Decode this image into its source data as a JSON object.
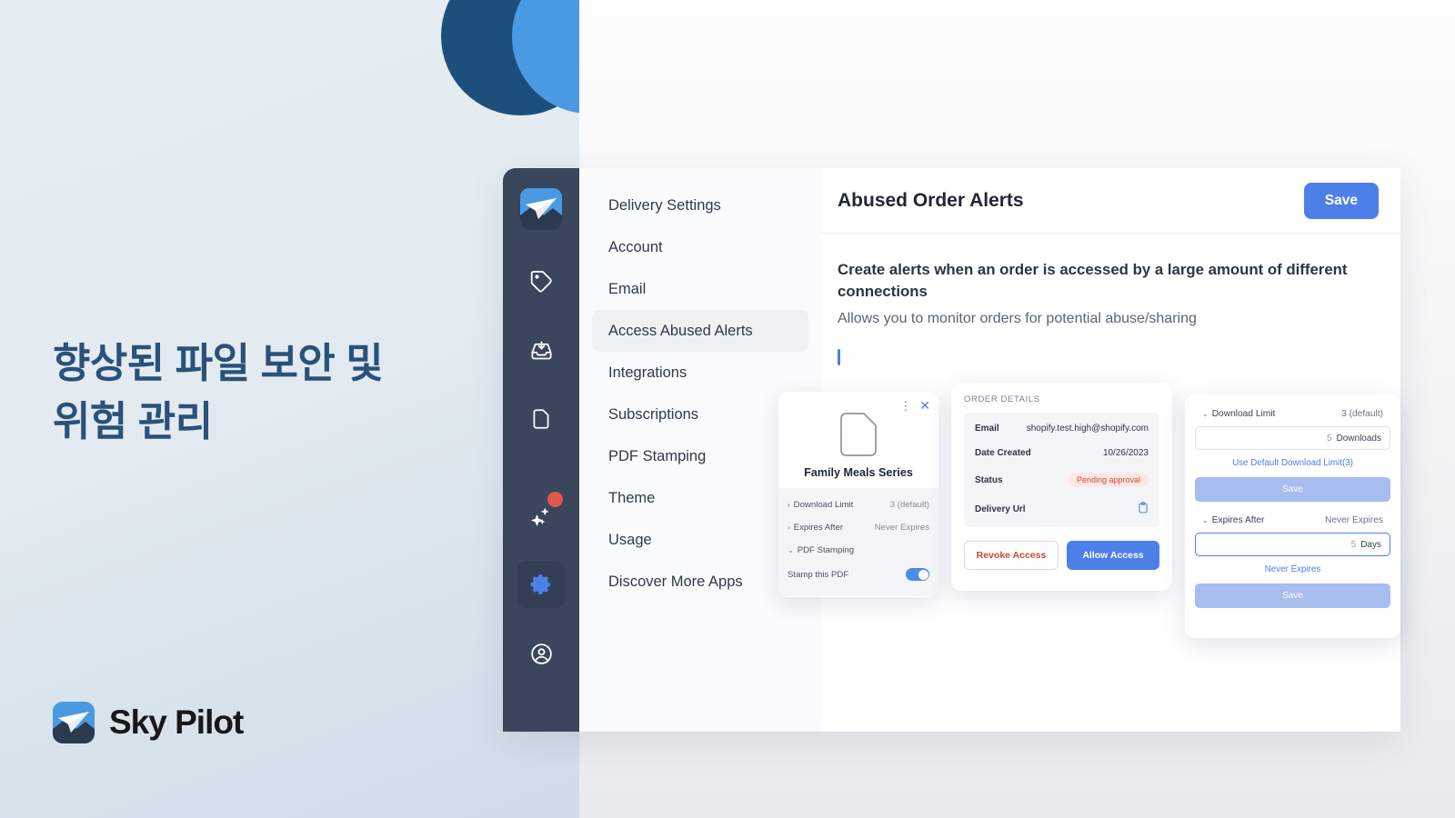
{
  "hero": {
    "headline_line1": "향상된 파일 보안 및",
    "headline_line2": "위험 관리",
    "brand": "Sky Pilot"
  },
  "colors": {
    "accent_blue": "#4d7fe8",
    "logo_blue": "#4a9ae3",
    "navy": "#1d4f7c",
    "rail": "#39465c",
    "danger": "#d3453a"
  },
  "rail": {
    "items": [
      {
        "name": "logo",
        "label": "Sky Pilot"
      },
      {
        "name": "tag-icon",
        "label": "Products"
      },
      {
        "name": "inbox-download-icon",
        "label": "Orders"
      },
      {
        "name": "document-icon",
        "label": "Files"
      },
      {
        "name": "sparkles-icon",
        "label": "What's New",
        "badge": true
      },
      {
        "name": "gear-icon",
        "label": "Settings",
        "active": true
      },
      {
        "name": "account-icon",
        "label": "Account"
      }
    ]
  },
  "menu": {
    "items": [
      {
        "label": "Delivery Settings",
        "active": false
      },
      {
        "label": "Account",
        "active": false
      },
      {
        "label": "Email",
        "active": false
      },
      {
        "label": "Access Abused Alerts",
        "active": true
      },
      {
        "label": "Integrations",
        "active": false
      },
      {
        "label": "Subscriptions",
        "active": false
      },
      {
        "label": "PDF Stamping",
        "active": false
      },
      {
        "label": "Theme",
        "active": false
      },
      {
        "label": "Usage",
        "active": false
      },
      {
        "label": "Discover More Apps",
        "active": false
      }
    ]
  },
  "main": {
    "title": "Abused Order Alerts",
    "save_label": "Save",
    "description_strong": "Create alerts when an order is accessed by a large amount of different connections",
    "description_sub": "Allows you to monitor orders for potential abuse/sharing"
  },
  "file_card": {
    "name": "Family Meals Series",
    "menu_icon": "⋮",
    "close_icon": "✕",
    "rows": [
      {
        "label": "Download Limit",
        "value": "3 (default)",
        "chevron": "›"
      },
      {
        "label": "Expires After",
        "value": "Never Expires",
        "chevron": "›"
      },
      {
        "label": "PDF Stamping",
        "value": "",
        "chevron": "⌄"
      }
    ],
    "toggle_label": "Stamp this PDF",
    "toggle_on": true
  },
  "order_card": {
    "title": "ORDER DETAILS",
    "rows": [
      {
        "key": "Email",
        "value": "shopify.test.high@shopify.com",
        "type": "text"
      },
      {
        "key": "Date Created",
        "value": "10/26/2023",
        "type": "text"
      },
      {
        "key": "Status",
        "value": "Pending approval",
        "type": "pill"
      },
      {
        "key": "Delivery Url",
        "value": "clipboard-icon",
        "type": "icon"
      }
    ],
    "revoke_label": "Revoke Access",
    "allow_label": "Allow Access"
  },
  "limits_card": {
    "download": {
      "label": "Download Limit",
      "value": "3 (default)",
      "chevron": "⌄",
      "input_number": "5",
      "input_unit": "Downloads",
      "link": "Use Default Download Limit(3)",
      "save_label": "Save"
    },
    "expires": {
      "label": "Expires After",
      "value": "Never Expires",
      "chevron": "⌄",
      "input_number": "5",
      "input_unit": "Days",
      "link": "Never Expires",
      "save_label": "Save"
    }
  }
}
